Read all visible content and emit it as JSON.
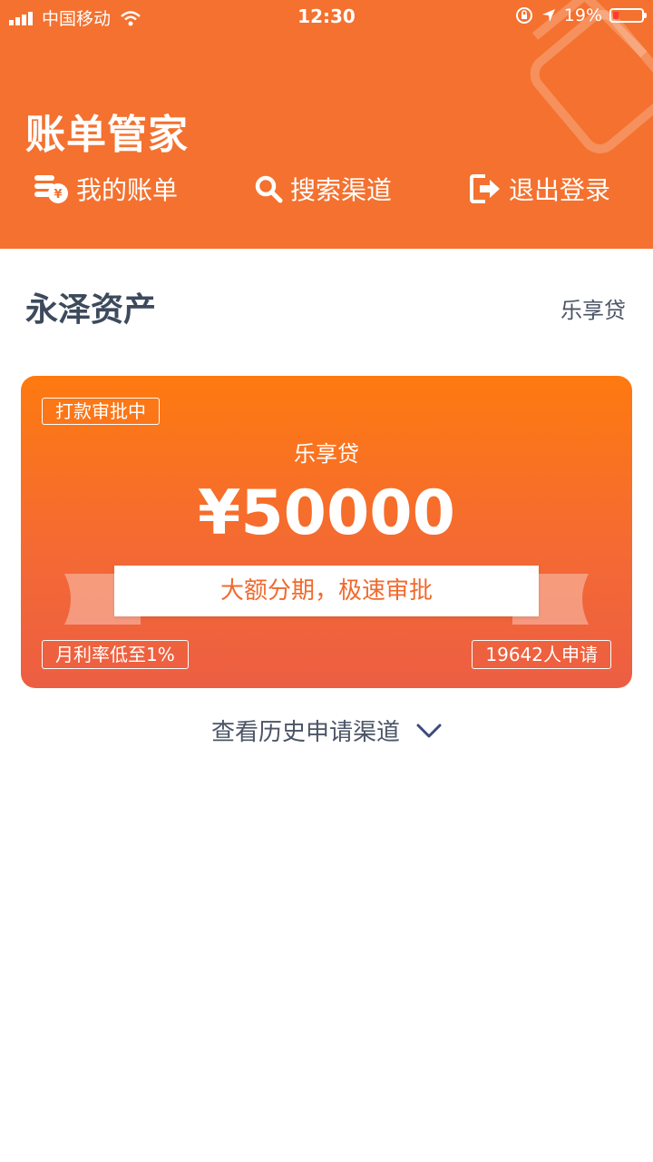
{
  "status_bar": {
    "carrier": "中国移动",
    "time": "12:30",
    "battery": "19%"
  },
  "header": {
    "title": "账单管家",
    "nav": [
      {
        "label": "我的账单",
        "icon": "bill-coins-icon"
      },
      {
        "label": "搜索渠道",
        "icon": "search-icon"
      },
      {
        "label": "退出登录",
        "icon": "logout-icon"
      }
    ]
  },
  "section": {
    "title": "永泽资产",
    "right_label": "乐享贷"
  },
  "card": {
    "status_tag": "打款审批中",
    "product_name": "乐享贷",
    "amount": "¥50000",
    "slogan": "大额分期，极速审批",
    "rate_tag": "月利率低至1%",
    "applicants_tag": "19642人申请"
  },
  "history": {
    "label": "查看历史申请渠道",
    "icon": "chevron-down-icon"
  },
  "colors": {
    "brand": "#f4712f",
    "card_top": "#fe7a10",
    "card_bottom": "#ec5e43",
    "slogan_text": "#f06a2e",
    "dark_text": "#3d4a5c"
  }
}
